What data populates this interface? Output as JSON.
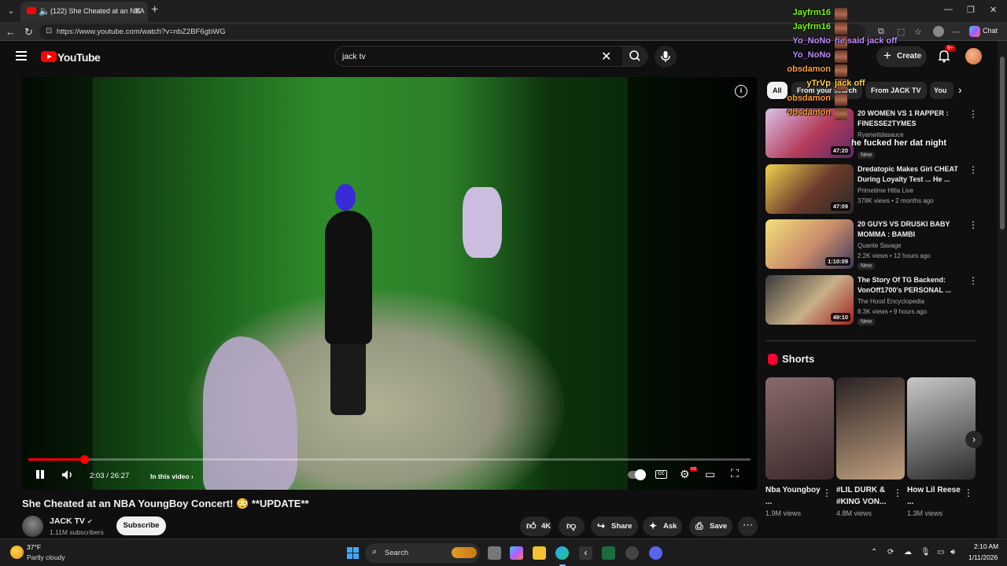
{
  "browser": {
    "tab_title": "(122) She Cheated at an NBA",
    "url": "https://www.youtube.com/watch?v=nbZ2BF6gbWG",
    "copilot_label": "Chat"
  },
  "youtube": {
    "wordmark": "YouTube",
    "search_value": "jack tv",
    "create_label": "Create",
    "notification_count": "9+"
  },
  "player": {
    "time": "2:03 / 26:27",
    "chapter_label": "In this video",
    "progress_fraction": 0.0775,
    "hd_badge": "HD"
  },
  "video": {
    "title": "She Cheated at an NBA YoungBoy Concert! 😳 **UPDATE**",
    "channel": "JACK TV",
    "subscribers": "1.11M subscribers",
    "subscribe_label": "Subscribe",
    "likes": "4K",
    "share_label": "Share",
    "ask_label": "Ask",
    "save_label": "Save"
  },
  "chips": [
    "All",
    "From your search",
    "From JACK TV",
    "You"
  ],
  "recommendations": [
    {
      "title": "20 WOMEN VS 1 RAPPER : FINESSE2TYMES",
      "channel": "Ryanwitdasauce",
      "meta": "",
      "badge": "New",
      "duration": "47:20",
      "thumb_colors": [
        "#d8c2e8",
        "#b43a5a",
        "#5a2a6a"
      ]
    },
    {
      "title": "Dredatopic Makes Girl CHEAT During Loyalty Test ... He ...",
      "channel": "Primetime Hitla Live",
      "meta": "378K views • 2 months ago",
      "badge": "",
      "duration": "47:09",
      "thumb_colors": [
        "#f0d250",
        "#6a3a2a",
        "#2a2a2a"
      ]
    },
    {
      "title": "20 GUYS VS DRUSKI BABY MOMMA : BAMBI",
      "channel": "Quante Savage",
      "meta": "2.2K views • 12 hours ago",
      "badge": "New",
      "duration": "1:10:09",
      "thumb_colors": [
        "#f2e07a",
        "#c98a6a",
        "#3a3a5a"
      ]
    },
    {
      "title": "The Story Of TG Backend: VonOff1700's PERSONAL ...",
      "channel": "The Hood Encyclopedia",
      "meta": "8.3K views • 9 hours ago",
      "badge": "New",
      "duration": "49:10",
      "thumb_colors": [
        "#3a3a3a",
        "#c8b088",
        "#a02020"
      ]
    }
  ],
  "shorts": {
    "title": "Shorts",
    "items": [
      {
        "title": "Nba Youngboy ...",
        "views": "1.9M views",
        "thumb_colors": [
          "#8a6a6a",
          "#3a2a2a"
        ]
      },
      {
        "title": "#LIL DURK & #KING VON...",
        "views": "4.8M views",
        "thumb_colors": [
          "#2a2222",
          "#c0a080"
        ]
      },
      {
        "title": "How Lil Reese ...",
        "views": "1.3M views",
        "thumb_colors": [
          "#c8c8c8",
          "#2a2a2a"
        ]
      }
    ]
  },
  "chat": [
    {
      "user": "Jayfrm16",
      "message": "",
      "color": "#7cfc00"
    },
    {
      "user": "Jayfrm16",
      "message": "",
      "color": "#7cfc00"
    },
    {
      "user": "Yo_NoNo",
      "message": "he said jack off",
      "color": "#c48cff"
    },
    {
      "user": "Yo_NoNo",
      "message": "",
      "color": "#c48cff"
    },
    {
      "user": "obsdamon",
      "message": "",
      "color": "#ff9c3a"
    },
    {
      "user": "yTrVp",
      "message": "jack off",
      "color": "#ffd23a"
    },
    {
      "user": "obsdamon",
      "message": "",
      "color": "#ff9c3a"
    },
    {
      "user": "obsdamon",
      "message": "",
      "color": "#ff9c3a"
    },
    {
      "user": "",
      "message": "he fucked her dat night",
      "color": "#ffffff"
    }
  ],
  "taskbar": {
    "temperature": "37°F",
    "condition": "Partly cloudy",
    "search_label": "Search",
    "time": "2:10 AM",
    "date": "1/11/2026"
  },
  "icons": {
    "tab_audio": "speaker-icon",
    "search": "magnifier-icon",
    "mic": "microphone-icon",
    "bell": "bell-icon",
    "like": "thumbs-up-icon",
    "dislike": "thumbs-down-icon",
    "share": "share-arrow-icon",
    "ask": "sparkle-icon",
    "save": "bookmark-icon"
  },
  "colors": {
    "yt_red": "#ff0000",
    "background": "#0f0f0f",
    "chip_bg": "#272727"
  }
}
